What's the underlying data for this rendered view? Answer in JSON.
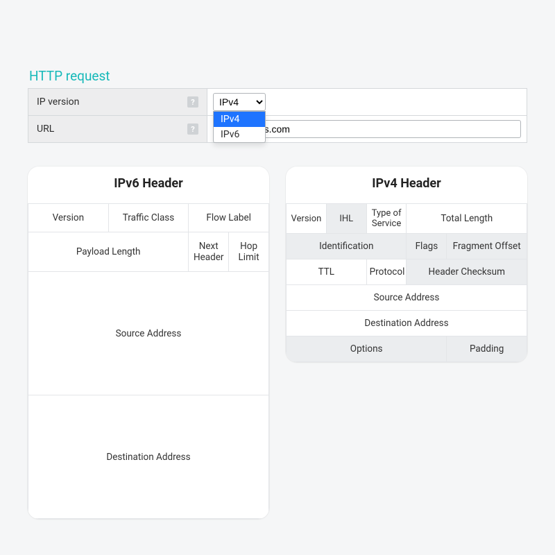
{
  "form": {
    "title": "HTTP request",
    "rows": {
      "ip_version": {
        "label": "IP version",
        "help": "?"
      },
      "url": {
        "label": "URL",
        "help": "?",
        "value": "acticresorts.com"
      }
    },
    "select": {
      "current": "IPv4",
      "options": [
        "IPv4",
        "IPv6"
      ]
    }
  },
  "ipv6": {
    "title": "IPv6 Header",
    "r1": {
      "version": "Version",
      "traffic": "Traffic Class",
      "flow": "Flow Label"
    },
    "r2": {
      "payload": "Payload Length",
      "next": "Next Header",
      "hop": "Hop Limit"
    },
    "r3": {
      "src": "Source Address"
    },
    "r4": {
      "dst": "Destination Address"
    }
  },
  "ipv4": {
    "title": "IPv4 Header",
    "r1": {
      "version": "Version",
      "ihl": "IHL",
      "tos": "Type of Service",
      "len": "Total Length"
    },
    "r2": {
      "id": "Identification",
      "flags": "Flags",
      "frag": "Fragment Offset"
    },
    "r3": {
      "ttl": "TTL",
      "proto": "Protocol",
      "chk": "Header Checksum"
    },
    "r4": {
      "src": "Source Address"
    },
    "r5": {
      "dst": "Destination Address"
    },
    "r6": {
      "opt": "Options",
      "pad": "Padding"
    }
  }
}
